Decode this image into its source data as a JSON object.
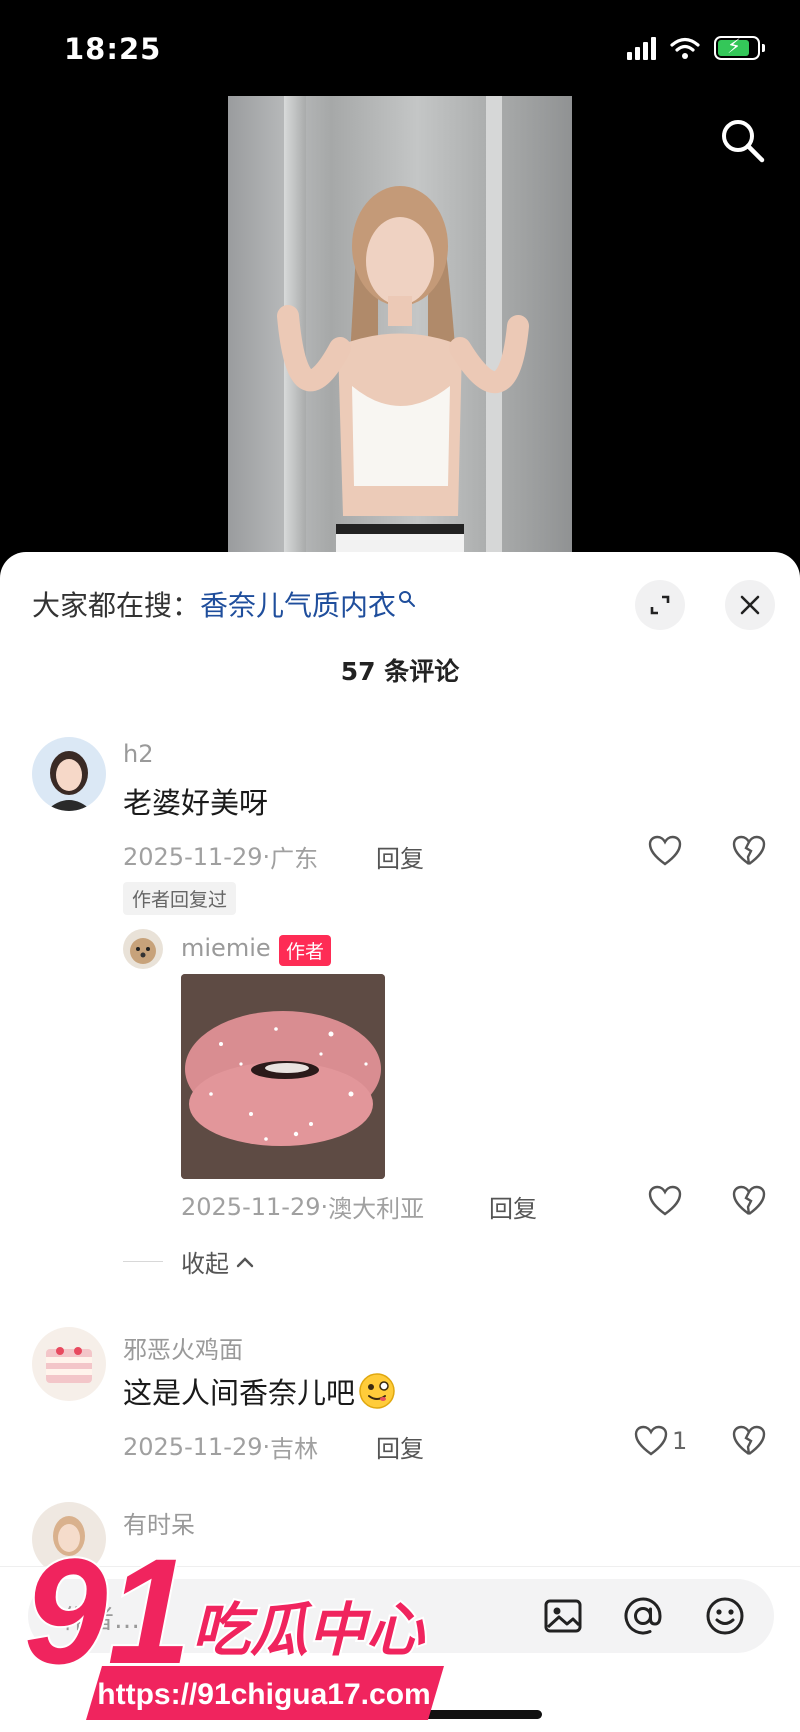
{
  "status_bar": {
    "time": "18:25",
    "battery_color": "#34c759"
  },
  "top_actions": {
    "search_icon": "search-icon"
  },
  "sheet": {
    "trending_prefix": "大家都在搜：",
    "trending_term": "香奈儿气质内衣",
    "expand_icon": "expand-icon",
    "close_icon": "close-icon",
    "comment_count": "57 条评论"
  },
  "comments": [
    {
      "username": "h2",
      "text": "老婆好美呀",
      "date": "2025-11-29",
      "location": "广东",
      "reply_label": "回复",
      "likes": "",
      "author_replied_badge": "作者回复过",
      "replies": [
        {
          "username": "miemie",
          "author_badge": "作者",
          "date": "2025-11-29",
          "location": "澳大利亚",
          "reply_label": "回复"
        }
      ],
      "collapse_label": "收起"
    },
    {
      "username": "邪恶火鸡面",
      "text": "这是人间香奈儿吧",
      "date": "2025-11-29",
      "location": "吉林",
      "reply_label": "回复",
      "likes": "1"
    },
    {
      "username": "有时呆",
      "text": "…"
    }
  ],
  "input_bar": {
    "placeholder": "作者…",
    "image_icon": "image-icon",
    "mention_icon": "at-icon",
    "emoji_icon": "emoji-icon"
  },
  "watermark": {
    "logo_number": "91",
    "logo_text": "吃瓜中心",
    "url": "https://91chigua17.com"
  },
  "colors": {
    "accent_red": "#fe2c55",
    "link_blue": "#1f4e9c",
    "watermark_pink": "#f0245e"
  }
}
